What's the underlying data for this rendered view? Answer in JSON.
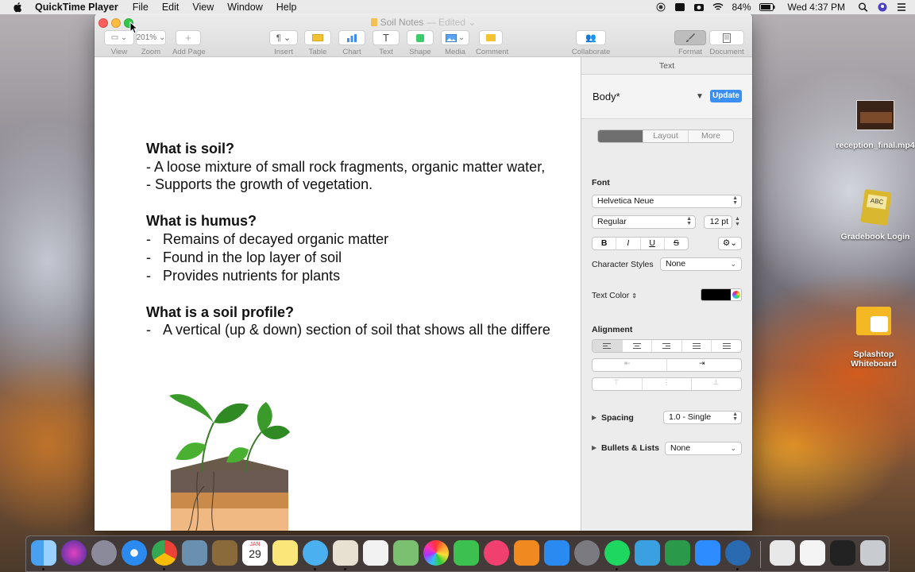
{
  "menubar": {
    "app_name": "QuickTime Player",
    "menus": [
      "File",
      "Edit",
      "View",
      "Window",
      "Help"
    ],
    "battery": "84%",
    "clock": "Wed 4:37 PM"
  },
  "window": {
    "title": "Soil Notes",
    "title_status": "— Edited",
    "toolbar": {
      "view": "View",
      "zoom_value": "201%",
      "zoom": "Zoom",
      "add_page": "Add Page",
      "insert": "Insert",
      "table": "Table",
      "chart": "Chart",
      "text": "Text",
      "shape": "Shape",
      "media": "Media",
      "comment": "Comment",
      "collaborate": "Collaborate",
      "format": "Format",
      "document": "Document"
    }
  },
  "document": {
    "lines": [
      {
        "text": "What is soil?",
        "heading": true
      },
      {
        "text": "- A loose mixture of small rock fragments, organic matter water,",
        "heading": false
      },
      {
        "text": "- Supports the growth of vegetation.",
        "heading": false
      },
      {
        "text": "What is humus?",
        "heading": true
      },
      {
        "text": "Remains of decayed organic matter",
        "heading": false,
        "dash": "-"
      },
      {
        "text": "Found in the lop layer of soil",
        "heading": false,
        "dash": "-"
      },
      {
        "text": "Provides nutrients for plants",
        "heading": false,
        "dash": "-"
      },
      {
        "text": "What is a soil profile?",
        "heading": true
      },
      {
        "text": "A vertical (up & down) section of soil that shows all the differe",
        "heading": false,
        "dash": "-"
      }
    ]
  },
  "inspector": {
    "header": "Text",
    "paragraph_style": "Body*",
    "update": "Update",
    "tabs": [
      "Style",
      "Layout",
      "More"
    ],
    "font_label": "Font",
    "font_family": "Helvetica Neue",
    "font_typeface": "Regular",
    "font_size": "12 pt",
    "bold": "B",
    "italic": "I",
    "underline": "U",
    "strike": "S",
    "char_styles_label": "Character Styles",
    "char_styles_value": "None",
    "text_color_label": "Text Color",
    "text_color": "#000000",
    "alignment_label": "Alignment",
    "spacing_label": "Spacing",
    "spacing_value": "1.0 - Single",
    "bullets_label": "Bullets & Lists",
    "bullets_value": "None"
  },
  "desktop_icons": [
    {
      "label": "reception_final.mp4"
    },
    {
      "label": "Gradebook Login"
    },
    {
      "label": "Splashtop Whiteboard"
    }
  ],
  "dock": {
    "calendar_month": "JAN",
    "calendar_day": "29"
  },
  "colors": {
    "accent": "#3b8ff2",
    "close": "#fc605c",
    "minimize": "#fdbc40",
    "zoom": "#34c84a"
  }
}
